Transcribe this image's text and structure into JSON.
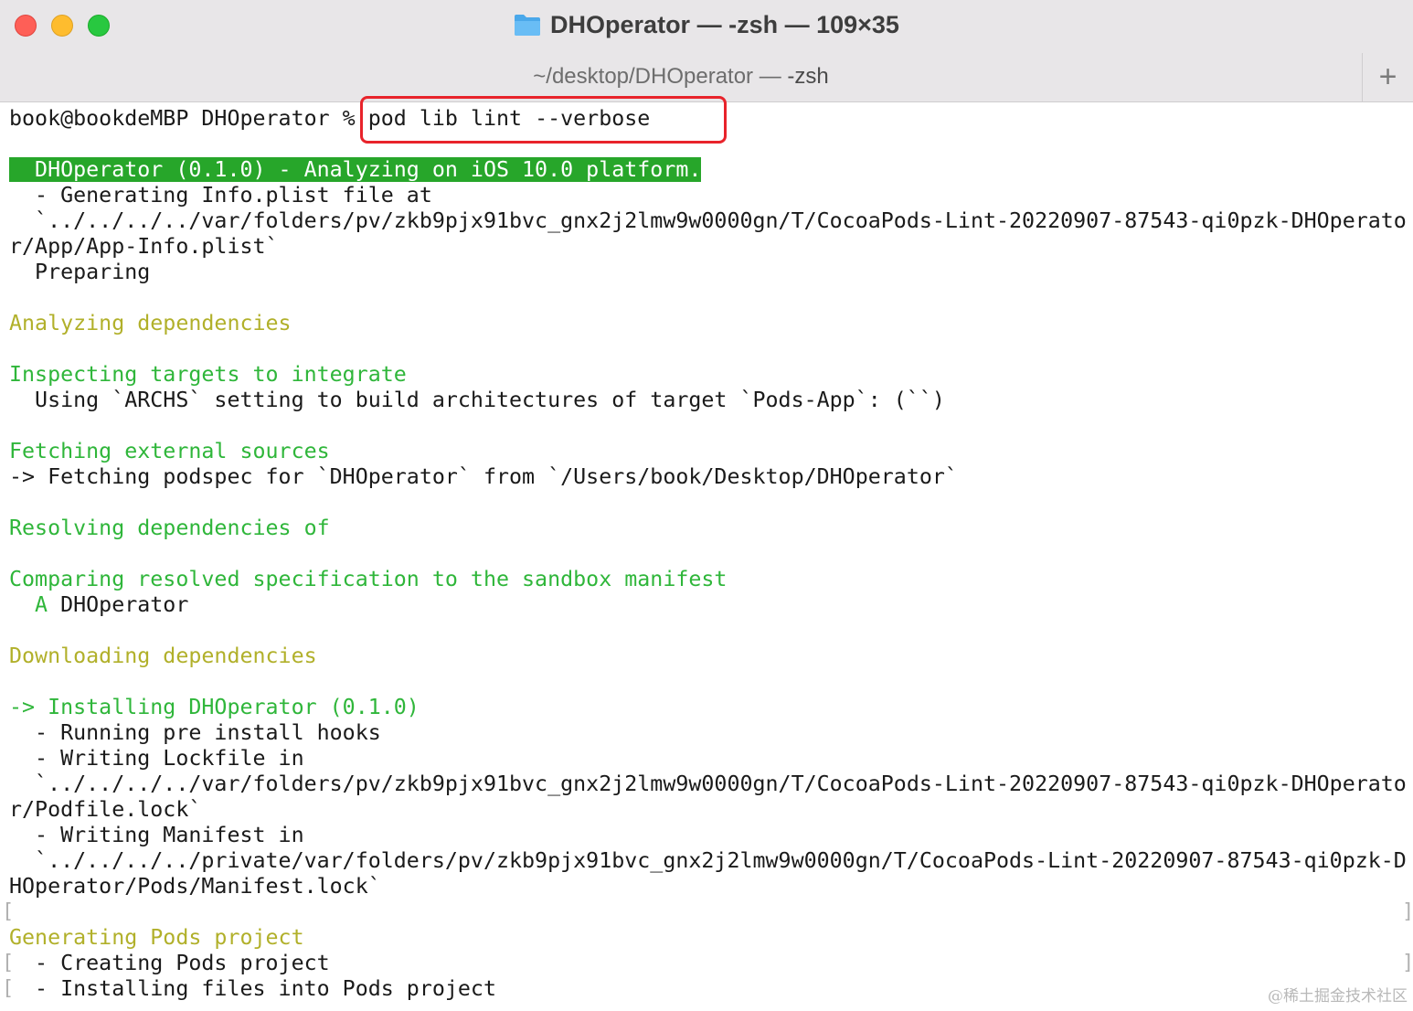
{
  "window": {
    "title": "DHOperator — -zsh — 109×35",
    "tab_label_dim": "~/desktop/DHOperator — ",
    "tab_label_strong": "-zsh",
    "new_tab": "+"
  },
  "terminal": {
    "prompt": "book@bookdeMBP DHOperator % ",
    "command": "pod lib lint --verbose",
    "lines": [
      "",
      "  DHOperator (0.1.0) - Analyzing on iOS 10.0 platform.",
      "  - Generating Info.plist file at",
      "  `../../../../var/folders/pv/zkb9pjx91bvc_gnx2j2lmw9w0000gn/T/CocoaPods-Lint-20220907-87543-qi0pzk-DHOperato",
      "r/App/App-Info.plist`",
      "  Preparing",
      "",
      "Analyzing dependencies",
      "",
      "Inspecting targets to integrate",
      "  Using `ARCHS` setting to build architectures of target `Pods-App`: (``)",
      "",
      "Fetching external sources",
      "-> Fetching podspec for `DHOperator` from `/Users/book/Desktop/DHOperator`",
      "",
      "Resolving dependencies of",
      "",
      "Comparing resolved specification to the sandbox manifest",
      "  A",
      "",
      "Downloading dependencies",
      "",
      "-> Installing DHOperator (0.1.0)",
      "  - Running pre install hooks",
      "  - Writing Lockfile in",
      "  `../../../../var/folders/pv/zkb9pjx91bvc_gnx2j2lmw9w0000gn/T/CocoaPods-Lint-20220907-87543-qi0pzk-DHOperato",
      "r/Podfile.lock`",
      "  - Writing Manifest in",
      "  `../../../../private/var/folders/pv/zkb9pjx91bvc_gnx2j2lmw9w0000gn/T/CocoaPods-Lint-20220907-87543-qi0pzk-D",
      "HOperator/Pods/Manifest.lock`",
      "",
      "Generating Pods project",
      "  - Creating Pods project",
      "  - Installing files into Pods project"
    ],
    "added_pod_name": " DHOperator"
  },
  "watermark": "@稀土掘金技术社区",
  "colors": {
    "green_text": "#2fb63a",
    "yellow_text": "#b1b02a",
    "banner_bg": "#27a62a",
    "highlight_border": "#e8232b"
  }
}
